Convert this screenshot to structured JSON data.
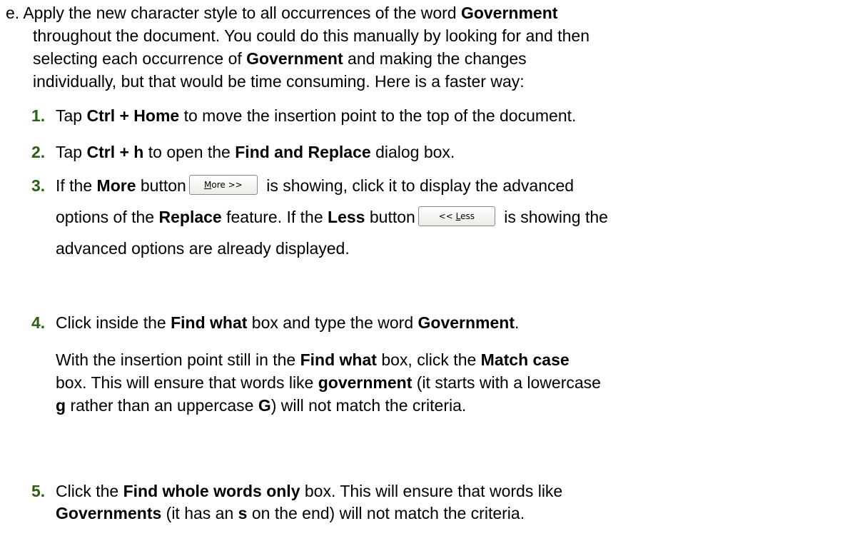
{
  "intro": {
    "label": "e.",
    "t1": "Apply the new character style to all occurrences of the word ",
    "b1": "Government",
    "t2": "throughout the document. You could do this manually by looking for and then",
    "t3": "selecting each occurrence of ",
    "b2": "Government",
    "t4": " and making the changes",
    "t5": "individually, but that would be time consuming. Here is a faster way:"
  },
  "steps": [
    {
      "num": "1.",
      "a": "Tap ",
      "b": "Ctrl + Home",
      "c": " to move the insertion point to the top of the document."
    },
    {
      "num": "2.",
      "a": "Tap ",
      "b": "Ctrl + h",
      "c": " to open the ",
      "d": "Find and Replace",
      "e": " dialog box."
    },
    {
      "num": "3.",
      "a": "If the ",
      "b": "More",
      "c": " button",
      "btn1_u": "M",
      "btn1_rest": "ore >>",
      "d": " is showing, click it to display the advanced",
      "e": "options of the ",
      "f": "Replace",
      "g": " feature. If the ",
      "h": "Less",
      "i": " button",
      "btn2_pre": "<< ",
      "btn2_u": "L",
      "btn2_rest": "ess",
      "j": " is showing the",
      "k": "advanced options are already displayed."
    },
    {
      "num": "4.",
      "a": "Click inside the ",
      "b": "Find what",
      "c": " box and type the word ",
      "d": "Government",
      "e": ".",
      "p2a": "With the insertion point still in the ",
      "p2b": "Find what",
      "p2c": " box, click the ",
      "p2d": "Match case",
      "p2e": "box. This will ensure that words like ",
      "p2f": "government",
      "p2g": " (it starts with a lowercase",
      "p2h": "g",
      "p2i": " rather than an uppercase ",
      "p2j": "G",
      "p2k": ") will not match the criteria."
    },
    {
      "num": "5.",
      "a": "Click the ",
      "b": "Find whole words only",
      "c": " box. This will ensure that words like",
      "d": "Governments",
      "e": " (it has an ",
      "f": "s",
      "g": " on the end) will not match the criteria."
    }
  ]
}
